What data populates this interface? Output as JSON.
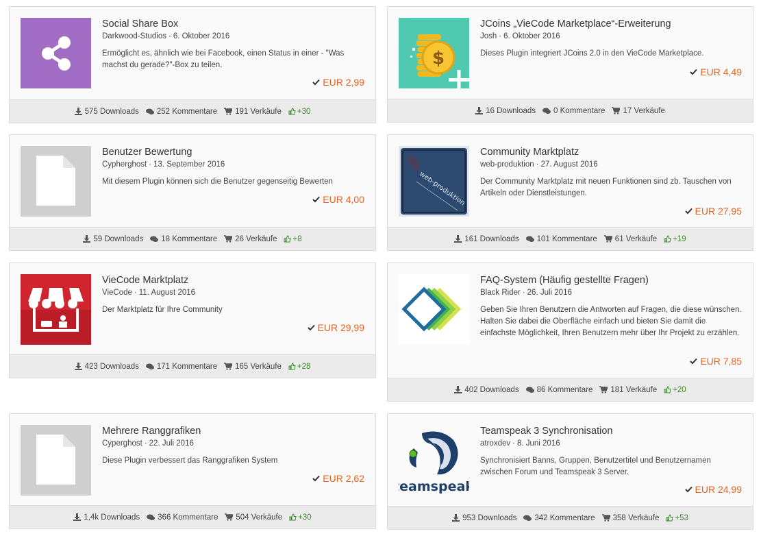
{
  "colors": {
    "price": "#e8631f",
    "likes": "#3b8a2a",
    "footer_bg": "#ebebeb"
  },
  "cards": [
    {
      "title": "Social Share Box",
      "author": "Darkwood-Studios",
      "date": "6. Oktober 2016",
      "description": "Ermöglicht es, ähnlich wie bei Facebook, einen Status in einer - \"Was machst du gerade?\"-Box zu teilen.",
      "price": "EUR 2,99",
      "downloads": "575 Downloads",
      "comments": "252 Kommentare",
      "sales": "191 Verkäufe",
      "likes": "+30",
      "icon": "share-icon"
    },
    {
      "title": "JCoins „VieCode Marketplace“-Erweiterung",
      "author": "Josh",
      "date": "6. Oktober 2016",
      "description": "Dieses Plugin integriert JCoins 2.0 in den VieCode Marketplace.",
      "price": "EUR 4,49",
      "downloads": "16 Downloads",
      "comments": "0 Kommentare",
      "sales": "17 Verkäufe",
      "likes": "",
      "icon": "coins-icon"
    },
    {
      "title": "Benutzer Bewertung",
      "author": "Cypherghost",
      "date": "13. September 2016",
      "description": "Mit diesem Plugin können sich die Benutzer gegenseitig Bewerten",
      "price": "EUR 4,00",
      "downloads": "59 Downloads",
      "comments": "18 Kommentare",
      "sales": "26 Verkäufe",
      "likes": "+8",
      "icon": "file-icon"
    },
    {
      "title": "Community Marktplatz",
      "author": "web-produktion",
      "date": "27. August 2016",
      "description": "Der Community Marktplatz mit neuen Funktionen sind zb. Tauschen von Artikeln oder Dienstleistungen.",
      "price": "EUR 27,95",
      "downloads": "161 Downloads",
      "comments": "101 Kommentare",
      "sales": "61 Verkäufe",
      "likes": "+19",
      "icon": "web-produktion-logo"
    },
    {
      "title": "VieCode Marktplatz",
      "author": "VieCode",
      "date": "11. August 2016",
      "description": "Der Marktplatz für Ihre Community",
      "price": "EUR 29,99",
      "downloads": "423 Downloads",
      "comments": "171 Kommentare",
      "sales": "165 Verkäufe",
      "likes": "+28",
      "icon": "market-stall-icon"
    },
    {
      "title": "FAQ-System (Häufig gestellte Fragen)",
      "author": "Black Rider",
      "date": "26. Juli 2016",
      "description": "Geben Sie Ihren Benutzern die Antworten auf Fragen, die diese wünschen. Halten Sie dabei die Oberfläche einfach und bieten Sie damit die einfachste Möglichkeit, Ihren Benutzern mehr über Ihr Projekt zu erzählen.",
      "price": "EUR 7,85",
      "downloads": "402 Downloads",
      "comments": "86 Kommentare",
      "sales": "181 Verkäufe",
      "likes": "+20",
      "icon": "faq-diamond-icon"
    },
    {
      "title": "Mehrere Ranggrafiken",
      "author": "Cyperghost",
      "date": "22. Juli 2016",
      "description": "Diese Plugin verbessert das Ranggrafiken System",
      "price": "EUR 2,62",
      "downloads": "1,4k Downloads",
      "comments": "366 Kommentare",
      "sales": "504 Verkäufe",
      "likes": "+30",
      "icon": "file-icon"
    },
    {
      "title": "Teamspeak 3 Synchronisation",
      "author": "atroxdev",
      "date": "8. Juni 2016",
      "description": "Synchronisiert Banns, Gruppen, Benutzertitel und Benutzernamen zwischen Forum und Teamspeak 3 Server.",
      "price": "EUR 24,99",
      "downloads": "953 Downloads",
      "comments": "342 Kommentare",
      "sales": "358 Verkäufe",
      "likes": "+53",
      "icon": "teamspeak-logo",
      "logo_text": "teamspeak"
    }
  ]
}
